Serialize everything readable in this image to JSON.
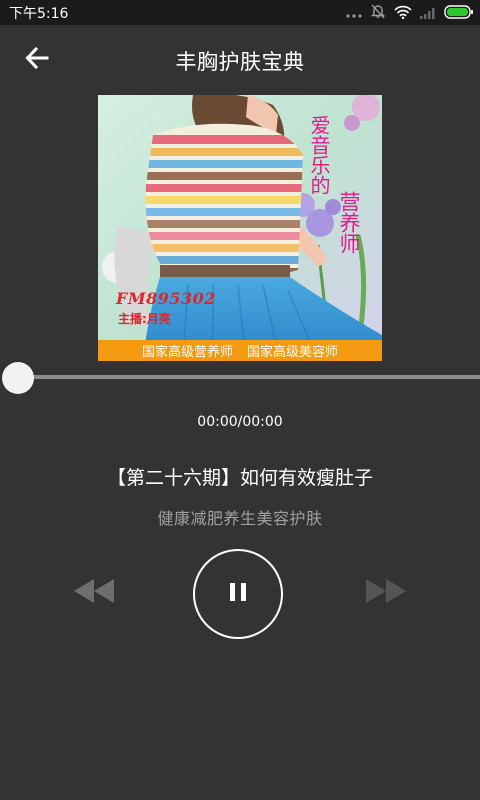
{
  "status_bar": {
    "time": "下午5:16",
    "icons": [
      "more-dots-icon",
      "bell-off-icon",
      "wifi-icon",
      "signal-icon",
      "battery-icon"
    ]
  },
  "header": {
    "back_icon": "arrow-left-icon",
    "title": "丰胸护肤宝典"
  },
  "cover": {
    "tagline_1": "爱音乐的",
    "tagline_2": "营养师",
    "fm": "FM895302",
    "host": "主播:月亮",
    "banner_left": "国家高级营养师",
    "banner_right": "国家高级美容师"
  },
  "player": {
    "progress": 0,
    "time": "00:00/00:00",
    "track_title": "【第二十六期】如何有效瘦肚子",
    "track_subtitle": "健康减肥养生美容护肤",
    "prev_icon": "rewind-icon",
    "play_icon": "pause-icon",
    "next_icon": "fast-forward-icon",
    "state": "playing"
  },
  "colors": {
    "background": "#333333",
    "statusbar": "#1b1b1b",
    "banner": "#f39a11",
    "tagline": "#e6198a",
    "fm_text": "#e0242a",
    "seek_track": "#8c8c8c",
    "subtitle": "#a0a0a0",
    "disabled_control": "#6e6e6e"
  }
}
